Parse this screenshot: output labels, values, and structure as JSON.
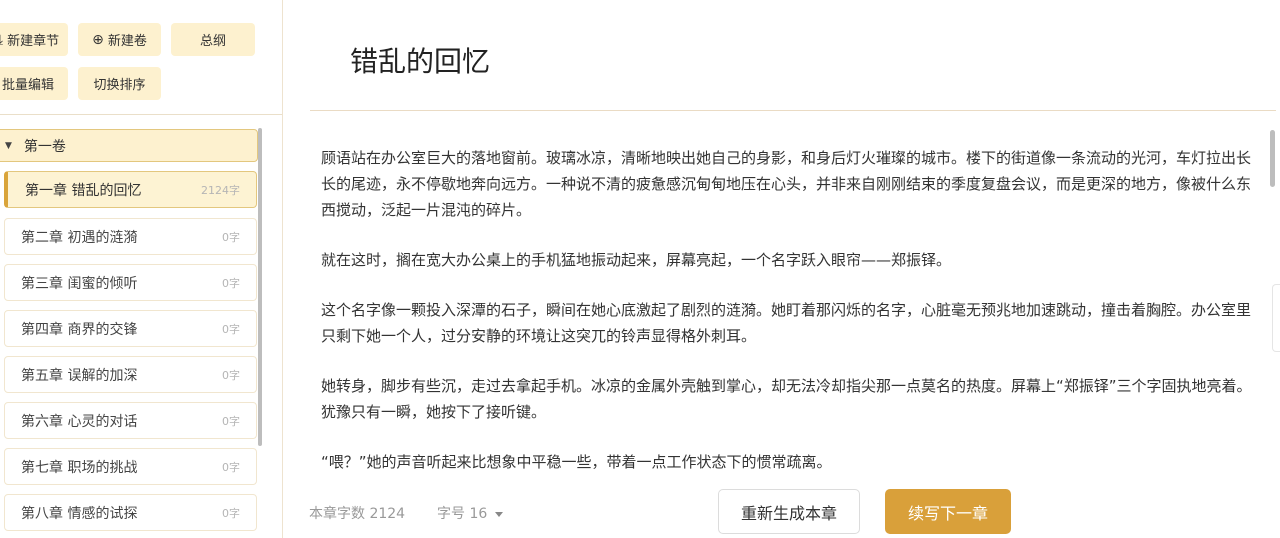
{
  "toolbar": {
    "new_chapter": "新建章节",
    "new_volume": "新建卷",
    "outline": "总纲",
    "batch_edit": "批量编辑",
    "toggle_sort": "切换排序"
  },
  "volume": {
    "label": "第一卷"
  },
  "chapters": [
    {
      "label": "第一章 错乱的回忆",
      "count": "2124字"
    },
    {
      "label": "第二章 初遇的涟漪",
      "count": "0字"
    },
    {
      "label": "第三章 闺蜜的倾听",
      "count": "0字"
    },
    {
      "label": "第四章 商界的交锋",
      "count": "0字"
    },
    {
      "label": "第五章 误解的加深",
      "count": "0字"
    },
    {
      "label": "第六章 心灵的对话",
      "count": "0字"
    },
    {
      "label": "第七章 职场的挑战",
      "count": "0字"
    },
    {
      "label": "第八章 情感的试探",
      "count": "0字"
    }
  ],
  "editor": {
    "title": "错乱的回忆",
    "paragraphs": [
      "顾语站在办公室巨大的落地窗前。玻璃冰凉，清晰地映出她自己的身影，和身后灯火璀璨的城市。楼下的街道像一条流动的光河，车灯拉出长长的尾迹，永不停歇地奔向远方。一种说不清的疲惫感沉甸甸地压在心头，并非来自刚刚结束的季度复盘会议，而是更深的地方，像被什么东西搅动，泛起一片混沌的碎片。",
      "就在这时，搁在宽大办公桌上的手机猛地振动起来，屏幕亮起，一个名字跃入眼帘——郑振铎。",
      "这个名字像一颗投入深潭的石子，瞬间在她心底激起了剧烈的涟漪。她盯着那闪烁的名字，心脏毫无预兆地加速跳动，撞击着胸腔。办公室里只剩下她一个人，过分安静的环境让这突兀的铃声显得格外刺耳。",
      "她转身，脚步有些沉，走过去拿起手机。冰凉的金属外壳触到掌心，却无法冷却指尖那一点莫名的热度。屏幕上“郑振铎”三个字固执地亮着。犹豫只有一瞬，她按下了接听键。",
      "“喂？”她的声音听起来比想象中平稳一些，带着一点工作状态下的惯常疏离。"
    ]
  },
  "footer": {
    "word_count": "本章字数 2124",
    "font_size": "字号 16",
    "regenerate": "重新生成本章",
    "continue": "续写下一章"
  }
}
